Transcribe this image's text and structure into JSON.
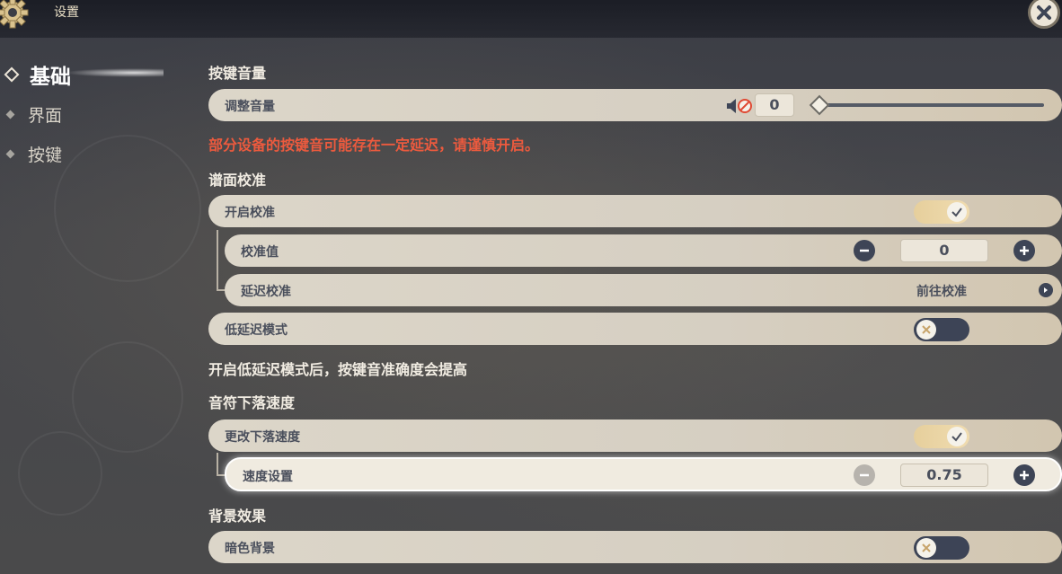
{
  "window": {
    "title": "设置"
  },
  "sidebar": {
    "items": [
      {
        "label": "基础",
        "active": true
      },
      {
        "label": "界面",
        "active": false
      },
      {
        "label": "按键",
        "active": false
      }
    ]
  },
  "key_volume": {
    "section_title": "按键音量",
    "adjust_label": "调整音量",
    "volume_value": "0",
    "slider_level": 0,
    "warning": "部分设备的按键音可能存在一定延迟，请谨慎开启。"
  },
  "calibration": {
    "section_title": "谱面校准",
    "enable_label": "开启校准",
    "enable_on": true,
    "offset_label": "校准值",
    "offset_value": "0",
    "latency_label": "延迟校准",
    "latency_link": "前往校准",
    "low_latency_label": "低延迟模式",
    "low_latency_on": false,
    "note": "开启低延迟模式后，按键音准确度会提高"
  },
  "note_speed": {
    "section_title": "音符下落速度",
    "change_label": "更改下落速度",
    "change_on": true,
    "speed_label": "速度设置",
    "speed_value": "0.75"
  },
  "background": {
    "section_title": "背景效果",
    "dark_label": "暗色背景",
    "dark_on": false
  },
  "colors": {
    "warning": "#ec5a3e",
    "row_bg": "#dcd6c9",
    "toggle_on": "#e6cf9c",
    "toggle_off": "#3d4456",
    "button_dark": "#3e4556"
  }
}
